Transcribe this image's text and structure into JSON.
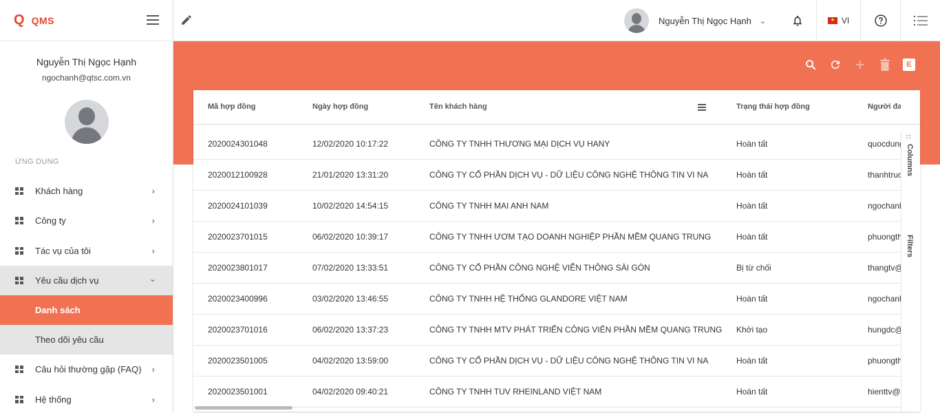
{
  "brand": {
    "logo": "Q",
    "name": "QMS"
  },
  "profile": {
    "name": "Nguyễn Thị Ngọc Hạnh",
    "email": "ngochanh@qtsc.com.vn"
  },
  "sidebar": {
    "section_label": "ỨNG DỤNG",
    "items": [
      {
        "label": "Khách hàng"
      },
      {
        "label": "Công ty"
      },
      {
        "label": "Tác vụ của tôi"
      },
      {
        "label": "Yêu cầu dịch vụ"
      },
      {
        "label": "Danh sách"
      },
      {
        "label": "Theo dõi yêu cầu"
      },
      {
        "label": "Câu hỏi thường gặp (FAQ)"
      },
      {
        "label": "Hệ thống"
      }
    ]
  },
  "header": {
    "user_name": "Nguyễn Thị Ngọc Hạnh",
    "language": "VI"
  },
  "toolbar": {
    "export_label": "E"
  },
  "grid": {
    "columns": [
      "Mã hợp đồng",
      "Ngày hợp đồng",
      "Tên khách hàng",
      "Trạng thái hợp đồng",
      "Người đang"
    ],
    "rows": [
      [
        "2020024301048",
        "12/02/2020 10:17:22",
        "CÔNG TY TNHH THƯƠNG MẠI DỊCH VỤ HANY",
        "Hoàn tất",
        "quocdung"
      ],
      [
        "2020012100928",
        "21/01/2020 13:31:20",
        "CÔNG TY CỔ PHẦN DỊCH VỤ - DỮ LIỆU CÔNG NGHỆ THÔNG TIN VI NA",
        "Hoàn tất",
        "thanhtruc"
      ],
      [
        "2020024101039",
        "10/02/2020 14:54:15",
        "CÔNG TY TNHH MAI ANH NAM",
        "Hoàn tất",
        "ngochanh"
      ],
      [
        "2020023701015",
        "06/02/2020 10:39:17",
        "CÔNG TY TNHH ƯƠM TẠO DOANH NGHIỆP PHẦN MỀM QUANG TRUNG",
        "Hoàn tất",
        "phuongth"
      ],
      [
        "2020023801017",
        "07/02/2020 13:33:51",
        "CÔNG TY CỔ PHẦN CÔNG NGHỆ VIỄN THÔNG SÀI GÒN",
        "Bị từ chối",
        "thangtv@"
      ],
      [
        "2020023400996",
        "03/02/2020 13:46:55",
        "CÔNG TY TNHH HỆ THỐNG GLANDORE VIỆT NAM",
        "Hoàn tất",
        "ngochanh"
      ],
      [
        "2020023701016",
        "06/02/2020 13:37:23",
        "CÔNG TY TNHH MTV PHÁT TRIỂN CÔNG VIÊN PHẦN MỀM QUANG TRUNG",
        "Khởi tạo",
        "hungdc@"
      ],
      [
        "2020023501005",
        "04/02/2020 13:59:00",
        "CÔNG TY CỔ PHẦN DỊCH VỤ - DỮ LIỆU CÔNG NGHỆ THÔNG TIN VI NA",
        "Hoàn tất",
        "phuongth"
      ],
      [
        "2020023501001",
        "04/02/2020 09:40:21",
        "CÔNG TY TNHH TUV RHEINLAND VIỆT NAM",
        "Hoàn tất",
        "hienttv@"
      ]
    ],
    "side_tabs": {
      "columns": "Columns",
      "filters": "Filters"
    }
  },
  "colors": {
    "accent": "#f07252",
    "brand": "#e8452c"
  }
}
